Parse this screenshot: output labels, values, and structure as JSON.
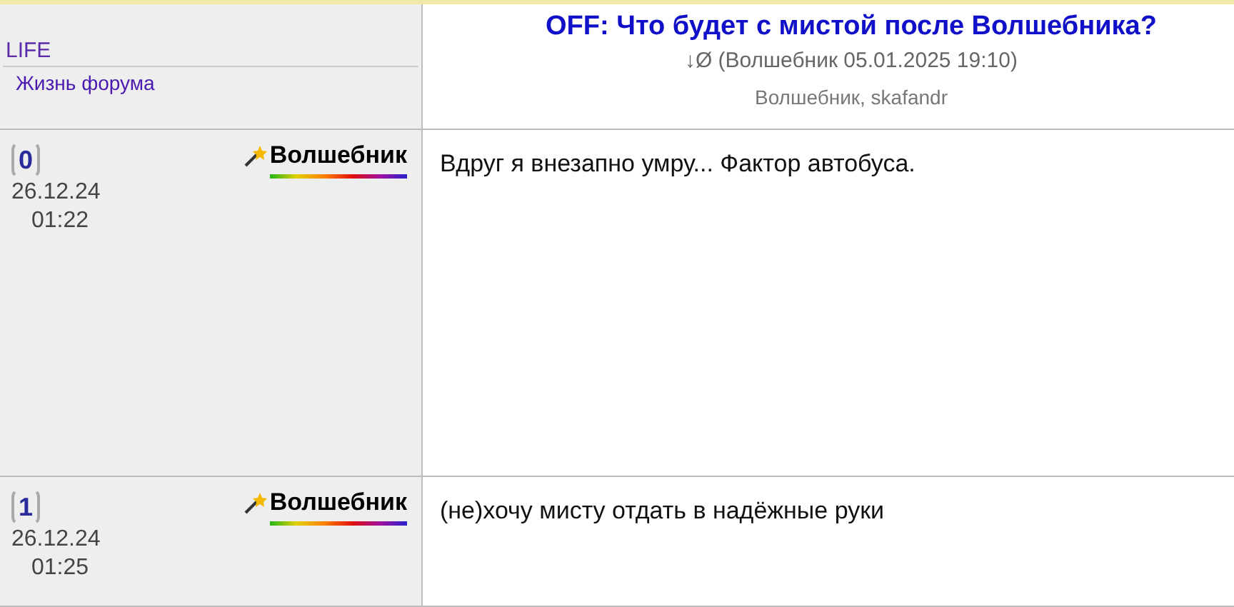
{
  "forum": {
    "code": "LIFE",
    "name": "Жизнь форума"
  },
  "topic": {
    "title": "OFF: Что будет с мистой после Волшебника?",
    "last_post_arrow": "↓Ø",
    "last_post": "(Волшебник 05.01.2025 19:10)",
    "participants": "Волшебник, skafandr"
  },
  "posts": [
    {
      "number": "0",
      "date": "26.12.24",
      "time": "01:22",
      "author": "Волшебник",
      "text": "Вдруг я внезапно умру... Фактор автобуса."
    },
    {
      "number": "1",
      "date": "26.12.24",
      "time": "01:25",
      "author": "Волшебник",
      "text": "(не)хочу мисту отдать в надёжные руки"
    }
  ]
}
